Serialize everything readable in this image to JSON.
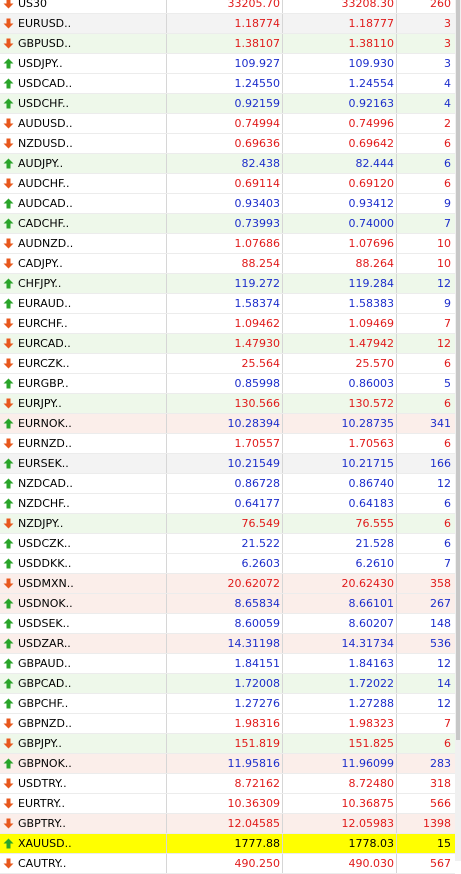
{
  "colors": {
    "up_text": "#1d2ecb",
    "down_text": "#e01b1b",
    "up_arrow": "#2aa52a",
    "down_arrow": "#e8581d",
    "highlight": "#ffff00"
  },
  "quotes": [
    {
      "symbol": "US30",
      "bid": "33205.70",
      "ask": "33208.30",
      "spread": "260",
      "dir": "down",
      "bg": "white"
    },
    {
      "symbol": "EURUSD..",
      "bid": "1.18774",
      "ask": "1.18777",
      "spread": "3",
      "dir": "down",
      "bg": "gray"
    },
    {
      "symbol": "GBPUSD..",
      "bid": "1.38107",
      "ask": "1.38110",
      "spread": "3",
      "dir": "down",
      "bg": "green"
    },
    {
      "symbol": "USDJPY..",
      "bid": "109.927",
      "ask": "109.930",
      "spread": "3",
      "dir": "up",
      "bg": "white"
    },
    {
      "symbol": "USDCAD..",
      "bid": "1.24550",
      "ask": "1.24554",
      "spread": "4",
      "dir": "up",
      "bg": "white"
    },
    {
      "symbol": "USDCHF..",
      "bid": "0.92159",
      "ask": "0.92163",
      "spread": "4",
      "dir": "up",
      "bg": "green"
    },
    {
      "symbol": "AUDUSD..",
      "bid": "0.74994",
      "ask": "0.74996",
      "spread": "2",
      "dir": "down",
      "bg": "white"
    },
    {
      "symbol": "NZDUSD..",
      "bid": "0.69636",
      "ask": "0.69642",
      "spread": "6",
      "dir": "down",
      "bg": "white"
    },
    {
      "symbol": "AUDJPY..",
      "bid": "82.438",
      "ask": "82.444",
      "spread": "6",
      "dir": "up",
      "bg": "green"
    },
    {
      "symbol": "AUDCHF..",
      "bid": "0.69114",
      "ask": "0.69120",
      "spread": "6",
      "dir": "down",
      "bg": "white"
    },
    {
      "symbol": "AUDCAD..",
      "bid": "0.93403",
      "ask": "0.93412",
      "spread": "9",
      "dir": "up",
      "bg": "white"
    },
    {
      "symbol": "CADCHF..",
      "bid": "0.73993",
      "ask": "0.74000",
      "spread": "7",
      "dir": "up",
      "bg": "green"
    },
    {
      "symbol": "AUDNZD..",
      "bid": "1.07686",
      "ask": "1.07696",
      "spread": "10",
      "dir": "down",
      "bg": "white"
    },
    {
      "symbol": "CADJPY..",
      "bid": "88.254",
      "ask": "88.264",
      "spread": "10",
      "dir": "down",
      "bg": "white"
    },
    {
      "symbol": "CHFJPY..",
      "bid": "119.272",
      "ask": "119.284",
      "spread": "12",
      "dir": "up",
      "bg": "green"
    },
    {
      "symbol": "EURAUD..",
      "bid": "1.58374",
      "ask": "1.58383",
      "spread": "9",
      "dir": "up",
      "bg": "white"
    },
    {
      "symbol": "EURCHF..",
      "bid": "1.09462",
      "ask": "1.09469",
      "spread": "7",
      "dir": "down",
      "bg": "white"
    },
    {
      "symbol": "EURCAD..",
      "bid": "1.47930",
      "ask": "1.47942",
      "spread": "12",
      "dir": "down",
      "bg": "green"
    },
    {
      "symbol": "EURCZK..",
      "bid": "25.564",
      "ask": "25.570",
      "spread": "6",
      "dir": "down",
      "bg": "white"
    },
    {
      "symbol": "EURGBP..",
      "bid": "0.85998",
      "ask": "0.86003",
      "spread": "5",
      "dir": "up",
      "bg": "white"
    },
    {
      "symbol": "EURJPY..",
      "bid": "130.566",
      "ask": "130.572",
      "spread": "6",
      "dir": "down",
      "bg": "green"
    },
    {
      "symbol": "EURNOK..",
      "bid": "10.28394",
      "ask": "10.28735",
      "spread": "341",
      "dir": "up",
      "bg": "pink"
    },
    {
      "symbol": "EURNZD..",
      "bid": "1.70557",
      "ask": "1.70563",
      "spread": "6",
      "dir": "down",
      "bg": "white"
    },
    {
      "symbol": "EURSEK..",
      "bid": "10.21549",
      "ask": "10.21715",
      "spread": "166",
      "dir": "up",
      "bg": "gray"
    },
    {
      "symbol": "NZDCAD..",
      "bid": "0.86728",
      "ask": "0.86740",
      "spread": "12",
      "dir": "up",
      "bg": "white"
    },
    {
      "symbol": "NZDCHF..",
      "bid": "0.64177",
      "ask": "0.64183",
      "spread": "6",
      "dir": "up",
      "bg": "white"
    },
    {
      "symbol": "NZDJPY..",
      "bid": "76.549",
      "ask": "76.555",
      "spread": "6",
      "dir": "down",
      "bg": "green"
    },
    {
      "symbol": "USDCZK..",
      "bid": "21.522",
      "ask": "21.528",
      "spread": "6",
      "dir": "up",
      "bg": "white"
    },
    {
      "symbol": "USDDKK..",
      "bid": "6.2603",
      "ask": "6.2610",
      "spread": "7",
      "dir": "up",
      "bg": "white"
    },
    {
      "symbol": "USDMXN..",
      "bid": "20.62072",
      "ask": "20.62430",
      "spread": "358",
      "dir": "down",
      "bg": "pink"
    },
    {
      "symbol": "USDNOK..",
      "bid": "8.65834",
      "ask": "8.66101",
      "spread": "267",
      "dir": "up",
      "bg": "pink"
    },
    {
      "symbol": "USDSEK..",
      "bid": "8.60059",
      "ask": "8.60207",
      "spread": "148",
      "dir": "up",
      "bg": "white"
    },
    {
      "symbol": "USDZAR..",
      "bid": "14.31198",
      "ask": "14.31734",
      "spread": "536",
      "dir": "up",
      "bg": "pink"
    },
    {
      "symbol": "GBPAUD..",
      "bid": "1.84151",
      "ask": "1.84163",
      "spread": "12",
      "dir": "up",
      "bg": "white"
    },
    {
      "symbol": "GBPCAD..",
      "bid": "1.72008",
      "ask": "1.72022",
      "spread": "14",
      "dir": "up",
      "bg": "green"
    },
    {
      "symbol": "GBPCHF..",
      "bid": "1.27276",
      "ask": "1.27288",
      "spread": "12",
      "dir": "up",
      "bg": "white"
    },
    {
      "symbol": "GBPNZD..",
      "bid": "1.98316",
      "ask": "1.98323",
      "spread": "7",
      "dir": "down",
      "bg": "white"
    },
    {
      "symbol": "GBPJPY..",
      "bid": "151.819",
      "ask": "151.825",
      "spread": "6",
      "dir": "down",
      "bg": "green"
    },
    {
      "symbol": "GBPNOK..",
      "bid": "11.95816",
      "ask": "11.96099",
      "spread": "283",
      "dir": "up",
      "bg": "pink"
    },
    {
      "symbol": "USDTRY..",
      "bid": "8.72162",
      "ask": "8.72480",
      "spread": "318",
      "dir": "down",
      "bg": "white"
    },
    {
      "symbol": "EURTRY..",
      "bid": "10.36309",
      "ask": "10.36875",
      "spread": "566",
      "dir": "down",
      "bg": "white"
    },
    {
      "symbol": "GBPTRY..",
      "bid": "12.04585",
      "ask": "12.05983",
      "spread": "1398",
      "dir": "down",
      "bg": "pink"
    },
    {
      "symbol": "XAUUSD..",
      "bid": "1777.88",
      "ask": "1778.03",
      "spread": "15",
      "dir": "up",
      "bg": "yellow"
    },
    {
      "symbol": "CAUTRY..",
      "bid": "490.250",
      "ask": "490.030",
      "spread": "567",
      "dir": "down",
      "bg": "white"
    }
  ]
}
